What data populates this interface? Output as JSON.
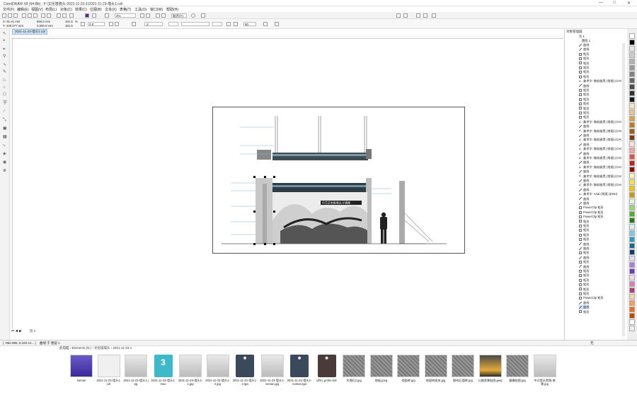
{
  "app": {
    "title": "CorelDRAW X8 (64-Bit) - F:\\文化墙墙头-2021-11-23-1\\2021-11-23-墙头1.cdr",
    "window_controls": [
      "—",
      "□",
      "✕"
    ]
  },
  "menu": [
    "文件(F)",
    "编辑(E)",
    "视图(V)",
    "布局(L)",
    "对象(C)",
    "效果(C)",
    "位图(B)",
    "文本(X)",
    "表格(T)",
    "工具(O)",
    "窗口(W)",
    "帮助(H)"
  ],
  "toolbar1": {
    "zoom": "2%",
    "snap": "贴齐(T)"
  },
  "toolbar2": {
    "x": "X: 91.41 mm",
    "y": "Y: 420.077 mm",
    "w": "650.0 mm",
    "h": "3,500.0 mm",
    "sx": "161.5",
    "sy": "161.5",
    "pct": "%",
    "angle": "0.0",
    "outline": ".2",
    "outline_val": "50"
  },
  "document_tab": "2021-11-23-墙头1.cdr",
  "object_manager": {
    "title": "对象管理器",
    "page": "页 1",
    "layer": "图层 1",
    "items": [
      {
        "icon": "curve",
        "label": "曲线"
      },
      {
        "icon": "curve",
        "label": "曲线"
      },
      {
        "icon": "rect",
        "label": "矩形"
      },
      {
        "icon": "rect",
        "label": "矩形"
      },
      {
        "icon": "rect",
        "label": "矩形"
      },
      {
        "icon": "rect",
        "label": "矩形"
      },
      {
        "icon": "rect",
        "label": "矩形"
      },
      {
        "icon": "rect",
        "label": "矩形"
      },
      {
        "icon": "text",
        "label": "美术字: 微软雅黑 (常规) (CHC)"
      },
      {
        "icon": "curve",
        "label": "曲线"
      },
      {
        "icon": "rect",
        "label": "矩形"
      },
      {
        "icon": "rect",
        "label": "矩形"
      },
      {
        "icon": "rect",
        "label": "矩形"
      },
      {
        "icon": "rect",
        "label": "矩形"
      },
      {
        "icon": "rect",
        "label": "矩形"
      },
      {
        "icon": "rect",
        "label": "矩形"
      },
      {
        "icon": "rect",
        "label": "矩形"
      },
      {
        "icon": "text",
        "label": "美术字: 微软雅黑 (常规) (CHC)"
      },
      {
        "icon": "curve",
        "label": "曲线"
      },
      {
        "icon": "text",
        "label": "美术字: 微软雅黑 (常规) (CHC)"
      },
      {
        "icon": "curve",
        "label": "曲线"
      },
      {
        "icon": "text",
        "label": "美术字: 微软雅黑 (常规) (CHC)"
      },
      {
        "icon": "curve",
        "label": "曲线"
      },
      {
        "icon": "text",
        "label": "美术字: 微软雅黑 (常规) (CHC)"
      },
      {
        "icon": "curve",
        "label": "曲线"
      },
      {
        "icon": "text",
        "label": "美术字: 微软雅黑 (常规) (CHC)"
      },
      {
        "icon": "curve",
        "label": "曲线"
      },
      {
        "icon": "text",
        "label": "美术字: 微软雅黑 (常规) (CHC)"
      },
      {
        "icon": "curve",
        "label": "曲线"
      },
      {
        "icon": "text",
        "label": "美术字: 微软雅黑 (常规) (CHC)"
      },
      {
        "icon": "curve",
        "label": "曲线"
      },
      {
        "icon": "text",
        "label": "美术字: 微软雅黑 (常规) (CHC)"
      },
      {
        "icon": "curve",
        "label": "曲线"
      },
      {
        "icon": "text",
        "label": "美术字: Arial (常规) (ENU)"
      },
      {
        "icon": "curve",
        "label": "曲线"
      },
      {
        "icon": "curve",
        "label": "曲线"
      },
      {
        "icon": "rect",
        "label": "PowerClip 矩形"
      },
      {
        "icon": "rect",
        "label": "PowerClip 矩形"
      },
      {
        "icon": "rect",
        "label": "PowerClip 矩形"
      },
      {
        "icon": "rect",
        "label": "矩形"
      },
      {
        "icon": "rect",
        "label": "矩形"
      },
      {
        "icon": "rect",
        "label": "矩形"
      },
      {
        "icon": "rect",
        "label": "矩形"
      },
      {
        "icon": "rect",
        "label": "矩形"
      },
      {
        "icon": "curve",
        "label": "曲线"
      },
      {
        "icon": "curve",
        "label": "曲线"
      },
      {
        "icon": "rect",
        "label": "矩形"
      },
      {
        "icon": "curve",
        "label": "曲线"
      },
      {
        "icon": "rect",
        "label": "矩形"
      },
      {
        "icon": "curve",
        "label": "曲线"
      },
      {
        "icon": "rect",
        "label": "矩形"
      },
      {
        "icon": "rect",
        "label": "矩形"
      },
      {
        "icon": "rect",
        "label": "矩形"
      },
      {
        "icon": "rect",
        "label": "矩形"
      },
      {
        "icon": "rect",
        "label": "矩形"
      },
      {
        "icon": "rect",
        "label": "矩形"
      },
      {
        "icon": "rect",
        "label": "PowerClip 矩形"
      },
      {
        "icon": "curve",
        "label": "曲线"
      },
      {
        "icon": "curve",
        "label": "曲线"
      },
      {
        "icon": "rect",
        "label": "矩形"
      }
    ]
  },
  "statusbar": {
    "coords": "( -952.985, 6,340.12... )",
    "layer_info": "曲线 于 图层 1",
    "fill": "无"
  },
  "explorer": {
    "breadcrumb": [
      "此电脑",
      "Elements (N:)",
      "文化墙墙头",
      "2021-11-23-1"
    ],
    "files": [
      {
        "name": "human",
        "type": "folder"
      },
      {
        "name": "2021-11-23-墙头1.cdr",
        "type": "cdr"
      },
      {
        "name": "2021-11-23-墙头1.jpg",
        "type": "jpg"
      },
      {
        "name": "2021-11-23-墙头1.max",
        "type": "max"
      },
      {
        "name": "2021-11-23-墙头1-1.jpg",
        "type": "jpg"
      },
      {
        "name": "2021-11-23-墙头1-2.jpg",
        "type": "jpg"
      },
      {
        "name": "2021-11-23-墙头1-2.tga",
        "type": "tga"
      },
      {
        "name": "2021-11-23-墙头1-noman.jpg",
        "type": "jpg"
      },
      {
        "name": "2021-11-23-墙头1-noman.tga",
        "type": "tga"
      },
      {
        "name": "uffizi_probe.hdr",
        "type": "raw"
      },
      {
        "name": "大理石2.jpg",
        "type": "tex"
      },
      {
        "name": "地板.jpeg",
        "type": "tex"
      },
      {
        "name": "地面砖.jpg",
        "type": "tex"
      },
      {
        "name": "地面砖面块.jpg",
        "type": "tex"
      },
      {
        "name": "颜祥石墙砖.jpg",
        "type": "tex"
      },
      {
        "name": "公路背景贴图.jpeg",
        "type": "sky"
      },
      {
        "name": "厦檐贴图.jpg",
        "type": "tex"
      },
      {
        "name": "中式墙头黑图-效果.jpg",
        "type": "jpg"
      }
    ]
  },
  "colors": {
    "accent": "#2a7fd4",
    "selection": "#cde6ff",
    "max_badge": "#3fb8c9",
    "tga_badge": "#3a4a5a",
    "raw_badge": "#4a3a3a"
  },
  "artwork": {
    "banner_text": "中式文化墙/墙头/示意图"
  }
}
